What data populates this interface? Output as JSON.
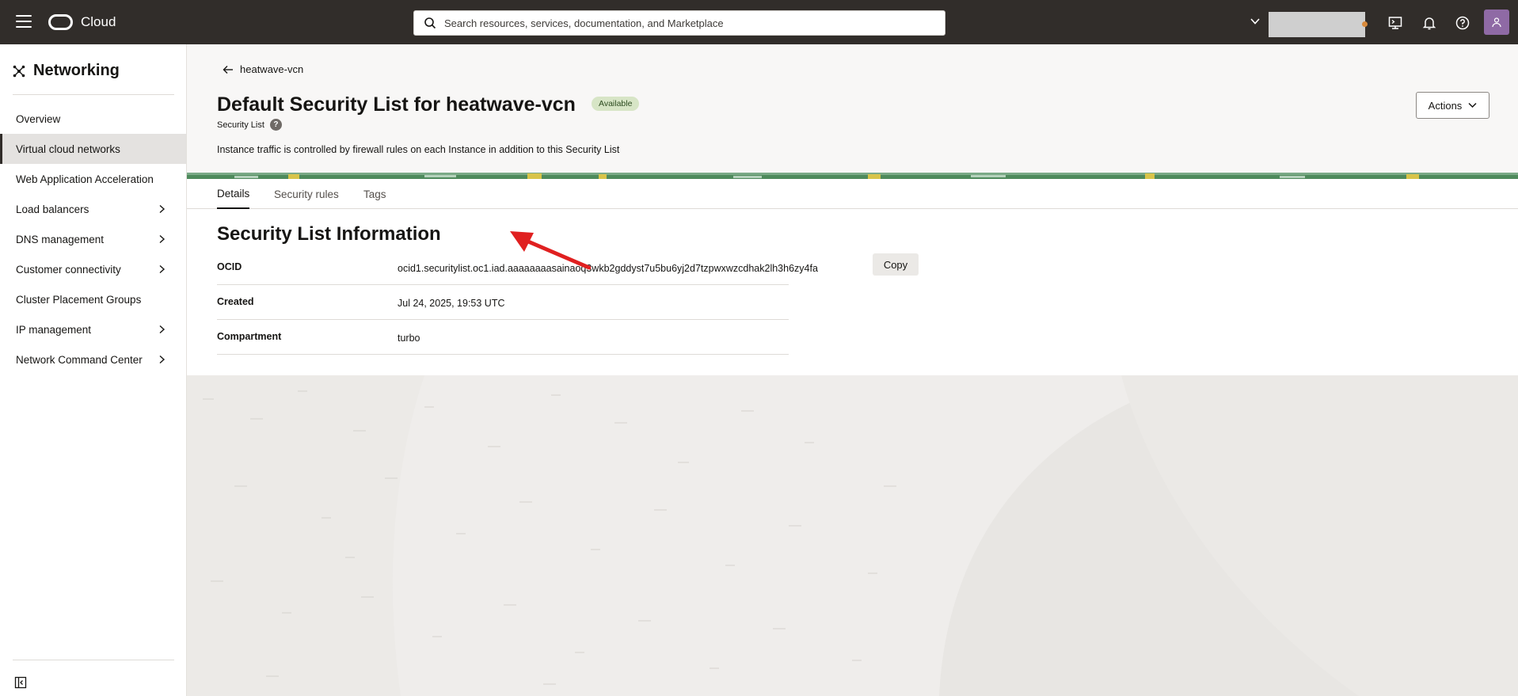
{
  "topbar": {
    "brand": "Cloud",
    "search_placeholder": "Search resources, services, documentation, and Marketplace"
  },
  "sidebar": {
    "title": "Networking",
    "items": [
      {
        "label": "Overview",
        "has_children": false
      },
      {
        "label": "Virtual cloud networks",
        "has_children": false,
        "active": true
      },
      {
        "label": "Web Application Acceleration",
        "has_children": false
      },
      {
        "label": "Load balancers",
        "has_children": true
      },
      {
        "label": "DNS management",
        "has_children": true
      },
      {
        "label": "Customer connectivity",
        "has_children": true
      },
      {
        "label": "Cluster Placement Groups",
        "has_children": false
      },
      {
        "label": "IP management",
        "has_children": true
      },
      {
        "label": "Network Command Center",
        "has_children": true
      }
    ]
  },
  "header": {
    "back_label": "heatwave-vcn",
    "title": "Default Security List for heatwave-vcn",
    "status": "Available",
    "resource_type": "Security List",
    "description": "Instance traffic is controlled by firewall rules on each Instance in addition to this Security List",
    "actions_label": "Actions"
  },
  "tabs": [
    {
      "label": "Details",
      "active": true
    },
    {
      "label": "Security rules",
      "active": false
    },
    {
      "label": "Tags",
      "active": false
    }
  ],
  "info": {
    "section_title": "Security List Information",
    "rows": [
      {
        "label": "OCID",
        "value": "ocid1.securitylist.oc1.iad.aaaaaaaasainaoq3wkb2gddyst7u5bu6yj2d7tzpwxwzcdhak2lh3h6zy4fa"
      },
      {
        "label": "Created",
        "value": "Jul 24, 2025, 19:53 UTC"
      },
      {
        "label": "Compartment",
        "value": "turbo"
      }
    ],
    "copy_label": "Copy"
  },
  "colors": {
    "topbar": "#312d2a",
    "badge_bg": "#d7e5c6",
    "annotation_arrow": "#e02020"
  }
}
